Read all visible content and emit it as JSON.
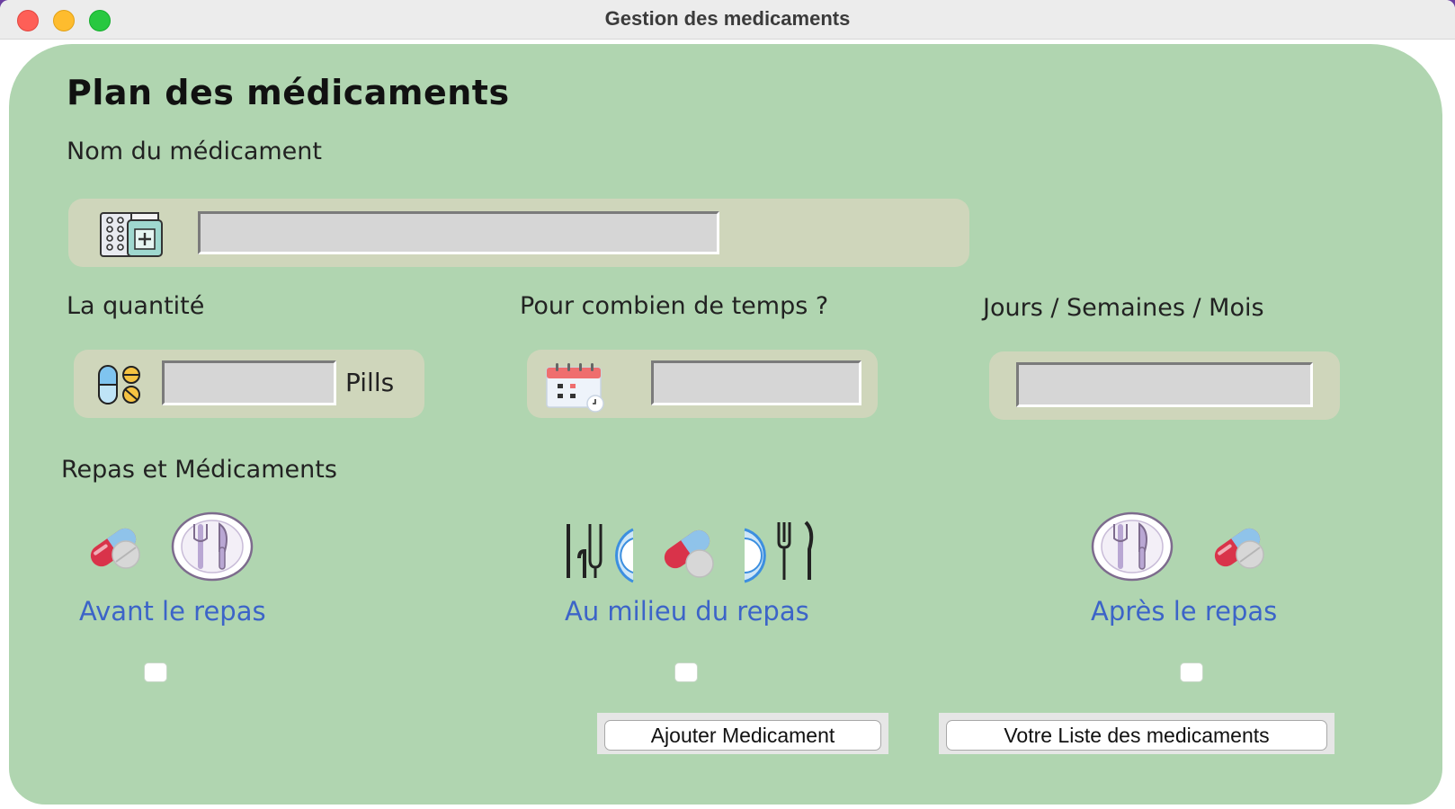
{
  "window": {
    "title": "Gestion des medicaments"
  },
  "form": {
    "heading": "Plan des médicaments",
    "name_label": "Nom du médicament",
    "name_value": "",
    "quantity_label": "La quantité",
    "quantity_value": "",
    "quantity_unit": "Pills",
    "duration_label": "Pour combien de temps ?",
    "duration_value": "",
    "period_label": "Jours / Semaines / Mois",
    "period_value": ""
  },
  "meals": {
    "section_label": "Repas et Médicaments",
    "before": {
      "label": "Avant le repas",
      "checked": false
    },
    "during": {
      "label": "Au milieu du repas",
      "checked": false
    },
    "after": {
      "label": "Après le repas",
      "checked": false
    }
  },
  "buttons": {
    "add": "Ajouter Medicament",
    "list": "Votre Liste des medicaments"
  },
  "icons": {
    "medicine": "pill-box-icon",
    "quantity": "capsule-pills-icon",
    "duration": "calendar-icon",
    "capsule": "capsule-icon",
    "plate": "plate-cutlery-icon",
    "during": "cutlery-plate-icon"
  },
  "colors": {
    "panel": "#b0d5b0",
    "field_box": "#cfd6bb",
    "meal_text": "#3c64c8"
  }
}
